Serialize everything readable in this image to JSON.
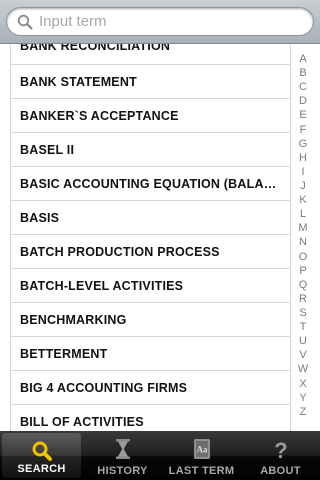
{
  "search": {
    "placeholder": "Input term"
  },
  "terms": [
    "BANK RECONCILIATION",
    "BANK STATEMENT",
    "BANKER`S ACCEPTANCE",
    "BASEL II",
    "BASIC ACCOUNTING EQUATION (BALAN…",
    "BASIS",
    "BATCH PRODUCTION PROCESS",
    "BATCH-LEVEL ACTIVITIES",
    "BENCHMARKING",
    "BETTERMENT",
    "BIG 4 ACCOUNTING FIRMS",
    "BILL OF ACTIVITIES"
  ],
  "index_letters": [
    "A",
    "B",
    "C",
    "D",
    "E",
    "F",
    "G",
    "H",
    "I",
    "J",
    "K",
    "L",
    "M",
    "N",
    "O",
    "P",
    "Q",
    "R",
    "S",
    "T",
    "U",
    "V",
    "W",
    "X",
    "Y",
    "Z"
  ],
  "tabs": [
    {
      "label": "SEARCH",
      "icon": "search-icon",
      "selected": true
    },
    {
      "label": "HISTORY",
      "icon": "hourglass-icon",
      "selected": false
    },
    {
      "label": "LAST TERM",
      "icon": "dictionary-icon",
      "selected": false
    },
    {
      "label": "ABOUT",
      "icon": "question-icon",
      "selected": false
    }
  ],
  "colors": {
    "accent_search_icon": "#f2c200",
    "tab_bar": "#111111",
    "text": "#111111",
    "index_text": "#7a7a7a"
  }
}
